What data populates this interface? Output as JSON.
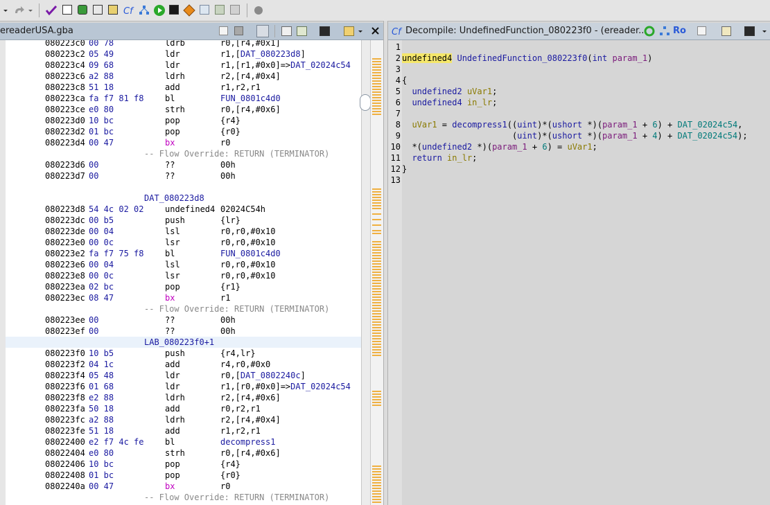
{
  "listing": {
    "title": "ereaderUSA.gba",
    "rows": [
      {
        "t": "ins",
        "addr": "080223c0",
        "bytes": "00 78",
        "mnem": "ldrb",
        "ops": "r0,[r4,#0x1]"
      },
      {
        "t": "ins",
        "addr": "080223c2",
        "bytes": "05 49",
        "mnem": "ldr",
        "ops": "r1,[DAT_080223d8]"
      },
      {
        "t": "ins",
        "addr": "080223c4",
        "bytes": "09 68",
        "mnem": "ldr",
        "ops": "r1,[r1,#0x0]=>DAT_02024c54"
      },
      {
        "t": "ins",
        "addr": "080223c6",
        "bytes": "a2 88",
        "mnem": "ldrh",
        "ops": "r2,[r4,#0x4]"
      },
      {
        "t": "ins",
        "addr": "080223c8",
        "bytes": "51 18",
        "mnem": "add",
        "ops": "r1,r2,r1"
      },
      {
        "t": "ins",
        "addr": "080223ca",
        "bytes": "fa f7 81 f8",
        "mnem": "bl",
        "ops": "FUN_0801c4d0"
      },
      {
        "t": "ins",
        "addr": "080223ce",
        "bytes": "e0 80",
        "mnem": "strh",
        "ops": "r0,[r4,#0x6]"
      },
      {
        "t": "ins",
        "addr": "080223d0",
        "bytes": "10 bc",
        "mnem": "pop",
        "ops": "{r4}"
      },
      {
        "t": "ins",
        "addr": "080223d2",
        "bytes": "01 bc",
        "mnem": "pop",
        "ops": "{r0}"
      },
      {
        "t": "ins",
        "addr": "080223d4",
        "bytes": "00 47",
        "mnem": "bx",
        "ops": "r0"
      },
      {
        "t": "flow",
        "text": "-- Flow Override: RETURN (TERMINATOR)"
      },
      {
        "t": "ins",
        "addr": "080223d6",
        "bytes": "00",
        "mnem": "??",
        "ops": "00h"
      },
      {
        "t": "ins",
        "addr": "080223d7",
        "bytes": "00",
        "mnem": "??",
        "ops": "00h"
      },
      {
        "t": "blank"
      },
      {
        "t": "label",
        "text": "DAT_080223d8"
      },
      {
        "t": "ins",
        "addr": "080223d8",
        "bytes": "54 4c 02 02",
        "mnem": "undefined4",
        "ops": "02024C54h"
      },
      {
        "t": "ins",
        "addr": "080223dc",
        "bytes": "00 b5",
        "mnem": "push",
        "ops": "{lr}"
      },
      {
        "t": "ins",
        "addr": "080223de",
        "bytes": "00 04",
        "mnem": "lsl",
        "ops": "r0,r0,#0x10"
      },
      {
        "t": "ins",
        "addr": "080223e0",
        "bytes": "00 0c",
        "mnem": "lsr",
        "ops": "r0,r0,#0x10"
      },
      {
        "t": "ins",
        "addr": "080223e2",
        "bytes": "fa f7 75 f8",
        "mnem": "bl",
        "ops": "FUN_0801c4d0"
      },
      {
        "t": "ins",
        "addr": "080223e6",
        "bytes": "00 04",
        "mnem": "lsl",
        "ops": "r0,r0,#0x10"
      },
      {
        "t": "ins",
        "addr": "080223e8",
        "bytes": "00 0c",
        "mnem": "lsr",
        "ops": "r0,r0,#0x10"
      },
      {
        "t": "ins",
        "addr": "080223ea",
        "bytes": "02 bc",
        "mnem": "pop",
        "ops": "{r1}"
      },
      {
        "t": "ins",
        "addr": "080223ec",
        "bytes": "08 47",
        "mnem": "bx",
        "ops": "r1"
      },
      {
        "t": "flow",
        "text": "-- Flow Override: RETURN (TERMINATOR)"
      },
      {
        "t": "ins",
        "addr": "080223ee",
        "bytes": "00",
        "mnem": "??",
        "ops": "00h"
      },
      {
        "t": "ins",
        "addr": "080223ef",
        "bytes": "00",
        "mnem": "??",
        "ops": "00h"
      },
      {
        "t": "label",
        "text": "LAB_080223f0+1",
        "hl": true
      },
      {
        "t": "ins",
        "addr": "080223f0",
        "bytes": "10 b5",
        "mnem": "push",
        "ops": "{r4,lr}"
      },
      {
        "t": "ins",
        "addr": "080223f2",
        "bytes": "04 1c",
        "mnem": "add",
        "ops": "r4,r0,#0x0"
      },
      {
        "t": "ins",
        "addr": "080223f4",
        "bytes": "05 48",
        "mnem": "ldr",
        "ops": "r0,[DAT_0802240c]"
      },
      {
        "t": "ins",
        "addr": "080223f6",
        "bytes": "01 68",
        "mnem": "ldr",
        "ops": "r1,[r0,#0x0]=>DAT_02024c54"
      },
      {
        "t": "ins",
        "addr": "080223f8",
        "bytes": "e2 88",
        "mnem": "ldrh",
        "ops": "r2,[r4,#0x6]"
      },
      {
        "t": "ins",
        "addr": "080223fa",
        "bytes": "50 18",
        "mnem": "add",
        "ops": "r0,r2,r1"
      },
      {
        "t": "ins",
        "addr": "080223fc",
        "bytes": "a2 88",
        "mnem": "ldrh",
        "ops": "r2,[r4,#0x4]"
      },
      {
        "t": "ins",
        "addr": "080223fe",
        "bytes": "51 18",
        "mnem": "add",
        "ops": "r1,r2,r1"
      },
      {
        "t": "ins",
        "addr": "08022400",
        "bytes": "e2 f7 4c fe",
        "mnem": "bl",
        "ops": "decompress1"
      },
      {
        "t": "ins",
        "addr": "08022404",
        "bytes": "e0 80",
        "mnem": "strh",
        "ops": "r0,[r4,#0x6]"
      },
      {
        "t": "ins",
        "addr": "08022406",
        "bytes": "10 bc",
        "mnem": "pop",
        "ops": "{r4}"
      },
      {
        "t": "ins",
        "addr": "08022408",
        "bytes": "01 bc",
        "mnem": "pop",
        "ops": "{r0}"
      },
      {
        "t": "ins",
        "addr": "0802240a",
        "bytes": "00 47",
        "mnem": "bx",
        "ops": "r0"
      },
      {
        "t": "flow",
        "text": "-- Flow Override: RETURN (TERMINATOR)"
      }
    ]
  },
  "decompile": {
    "title": "Decompile: UndefinedFunction_080223f0 - (ereader...",
    "ro_label": "Ro",
    "line_numbers": [
      "1",
      "2",
      "3",
      "4",
      "5",
      "6",
      "7",
      "8",
      "9",
      "10",
      "11",
      "12",
      "13"
    ],
    "lines": [
      [],
      [
        [
          "sel",
          "undefined4"
        ],
        [
          "t",
          " "
        ],
        [
          "fn",
          "UndefinedFunction_080223f0"
        ],
        [
          "t",
          "("
        ],
        [
          "ty",
          "int"
        ],
        [
          "t",
          " "
        ],
        [
          "var",
          "param_1"
        ],
        [
          "t",
          ")"
        ]
      ],
      [],
      [
        [
          "t",
          "{"
        ]
      ],
      [
        [
          "t",
          "  "
        ],
        [
          "ty",
          "undefined2"
        ],
        [
          "t",
          " "
        ],
        [
          "lv",
          "uVar1"
        ],
        [
          "t",
          ";"
        ]
      ],
      [
        [
          "t",
          "  "
        ],
        [
          "ty",
          "undefined4"
        ],
        [
          "t",
          " "
        ],
        [
          "lv",
          "in_lr"
        ],
        [
          "t",
          ";"
        ]
      ],
      [],
      [
        [
          "t",
          "  "
        ],
        [
          "lv",
          "uVar1"
        ],
        [
          "t",
          " = "
        ],
        [
          "fn",
          "decompress1"
        ],
        [
          "t",
          "(("
        ],
        [
          "ty",
          "uint"
        ],
        [
          "t",
          ")*("
        ],
        [
          "ty",
          "ushort"
        ],
        [
          "t",
          " *)("
        ],
        [
          "var",
          "param_1"
        ],
        [
          "t",
          " + "
        ],
        [
          "cnum",
          "6"
        ],
        [
          "t",
          ") + "
        ],
        [
          "glob",
          "DAT_02024c54"
        ],
        [
          "t",
          ","
        ]
      ],
      [
        [
          "t",
          "                      ("
        ],
        [
          "ty",
          "uint"
        ],
        [
          "t",
          ")*("
        ],
        [
          "ty",
          "ushort"
        ],
        [
          "t",
          " *)("
        ],
        [
          "var",
          "param_1"
        ],
        [
          "t",
          " + "
        ],
        [
          "cnum",
          "4"
        ],
        [
          "t",
          ") + "
        ],
        [
          "glob",
          "DAT_02024c54"
        ],
        [
          "t",
          ");"
        ]
      ],
      [
        [
          "t",
          "  *("
        ],
        [
          "ty",
          "undefined2"
        ],
        [
          "t",
          " *)("
        ],
        [
          "var",
          "param_1"
        ],
        [
          "t",
          " + "
        ],
        [
          "cnum",
          "6"
        ],
        [
          "t",
          ") = "
        ],
        [
          "lv",
          "uVar1"
        ],
        [
          "t",
          ";"
        ]
      ],
      [
        [
          "t",
          "  "
        ],
        [
          "kw",
          "return"
        ],
        [
          "t",
          " "
        ],
        [
          "lv",
          "in_lr"
        ],
        [
          "t",
          ";"
        ]
      ],
      [
        [
          "t",
          "}"
        ]
      ],
      []
    ]
  },
  "colors": {
    "selection": "#f5e76a",
    "listing_bytes": "#1a1aa0",
    "bx_mnemonic": "#c000c0",
    "flow_comment": "#888888",
    "overview_marks": "#f0b040"
  }
}
